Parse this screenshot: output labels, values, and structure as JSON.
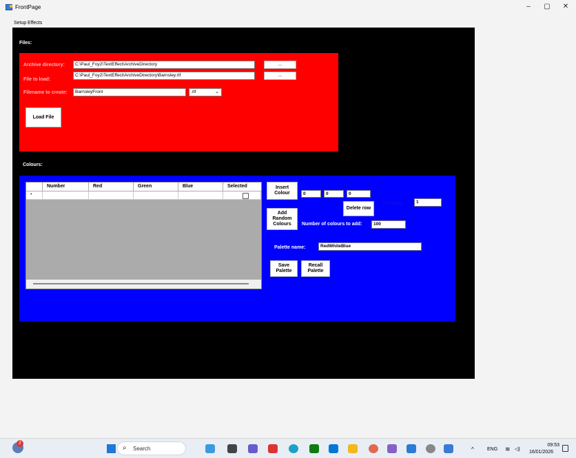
{
  "window": {
    "title": "FrontPage",
    "min_glyph": "–",
    "max_glyph": "▢",
    "close_glyph": "✕"
  },
  "menu": {
    "items": [
      "Setup",
      "Effects"
    ]
  },
  "files": {
    "heading": "Files:",
    "archive_label": "Archive directory:",
    "archive_value": "C:\\Paul_Foy2\\TextEffect\\ArchiveDirectory",
    "file_label": "File to load:",
    "file_value": "C:\\Paul_Foy2\\TextEffect\\ArchiveDirectory\\Barnsley.rtf",
    "create_label": "Filename to create:",
    "create_value": "BarnsleyFront",
    "ext_value": ".rtf",
    "browse_label": "...",
    "load_button": "Load File"
  },
  "colours": {
    "heading": "Colours:",
    "grid_headers": [
      "Number",
      "Red",
      "Green",
      "Blue",
      "Selected"
    ],
    "new_row_marker": "*",
    "insert_button": "Insert Colour",
    "rgb_values": [
      "0",
      "0",
      "0"
    ],
    "delete_button": "Delete row",
    "row_number_label": "# number",
    "row_number_value": "1",
    "add_random_button": "Add Random Colours",
    "num_to_add_label": "Number of colours to add:",
    "num_to_add_value": "100",
    "palette_label": "Palette name:",
    "palette_value": "RedWhiteBlue",
    "save_button": "Save Palette",
    "recall_button": "Recall Palette"
  },
  "taskbar": {
    "search_placeholder": "Search",
    "tray_caret": "^",
    "lang": "ENG",
    "wifi_glyph": "≋",
    "volume_glyph": "◁)",
    "time": "09:53",
    "date": "16/01/2026",
    "notification_badge": "2"
  },
  "colors": {
    "files_panel": "#ff0000",
    "colours_panel": "#0000ff",
    "main_bg": "#000000"
  }
}
